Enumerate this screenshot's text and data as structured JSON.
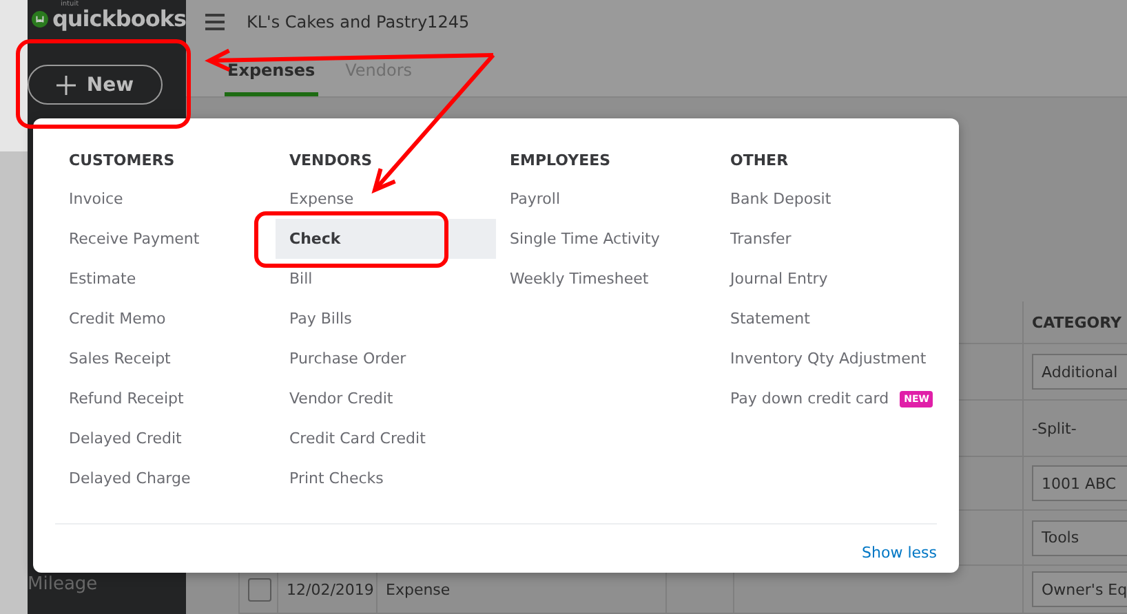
{
  "sidebar": {
    "logo_small": "intuit",
    "logo": "quickbooks",
    "new_button": "New",
    "items": [
      {
        "label": "Mileage"
      }
    ]
  },
  "header": {
    "company": "KL's Cakes and Pastry1245"
  },
  "tabs": [
    {
      "label": "Expenses",
      "selected": true
    },
    {
      "label": "Vendors",
      "selected": false
    }
  ],
  "table": {
    "columns": [
      "CATEGORY"
    ],
    "rows": [
      {
        "kind": "field",
        "category": "Additional"
      },
      {
        "kind": "plain",
        "category": "-Split-"
      },
      {
        "kind": "field",
        "category": "1001 ABC"
      },
      {
        "kind": "field",
        "category": "Tools"
      },
      {
        "kind": "field",
        "checked": false,
        "date": "12/02/2019",
        "type": "Expense",
        "category": "Owner's Eq"
      }
    ]
  },
  "new_menu": {
    "columns": [
      {
        "heading": "CUSTOMERS",
        "items": [
          {
            "label": "Invoice",
            "selected": false
          },
          {
            "label": "Receive Payment",
            "selected": false
          },
          {
            "label": "Estimate",
            "selected": false
          },
          {
            "label": "Credit Memo",
            "selected": false
          },
          {
            "label": "Sales Receipt",
            "selected": false
          },
          {
            "label": "Refund Receipt",
            "selected": false
          },
          {
            "label": "Delayed Credit",
            "selected": false
          },
          {
            "label": "Delayed Charge",
            "selected": false
          }
        ]
      },
      {
        "heading": "VENDORS",
        "items": [
          {
            "label": "Expense",
            "selected": false
          },
          {
            "label": "Check",
            "selected": true
          },
          {
            "label": "Bill",
            "selected": false
          },
          {
            "label": "Pay Bills",
            "selected": false
          },
          {
            "label": "Purchase Order",
            "selected": false
          },
          {
            "label": "Vendor Credit",
            "selected": false
          },
          {
            "label": "Credit Card Credit",
            "selected": false
          },
          {
            "label": "Print Checks",
            "selected": false
          }
        ]
      },
      {
        "heading": "EMPLOYEES",
        "items": [
          {
            "label": "Payroll",
            "selected": false
          },
          {
            "label": "Single Time Activity",
            "selected": false
          },
          {
            "label": "Weekly Timesheet",
            "selected": false
          }
        ]
      },
      {
        "heading": "OTHER",
        "items": [
          {
            "label": "Bank Deposit",
            "selected": false
          },
          {
            "label": "Transfer",
            "selected": false
          },
          {
            "label": "Journal Entry",
            "selected": false
          },
          {
            "label": "Statement",
            "selected": false
          },
          {
            "label": "Inventory Qty Adjustment",
            "selected": false
          },
          {
            "label": "Pay down credit card",
            "selected": false,
            "badge": "NEW"
          }
        ]
      }
    ],
    "footer_link": "Show less"
  }
}
